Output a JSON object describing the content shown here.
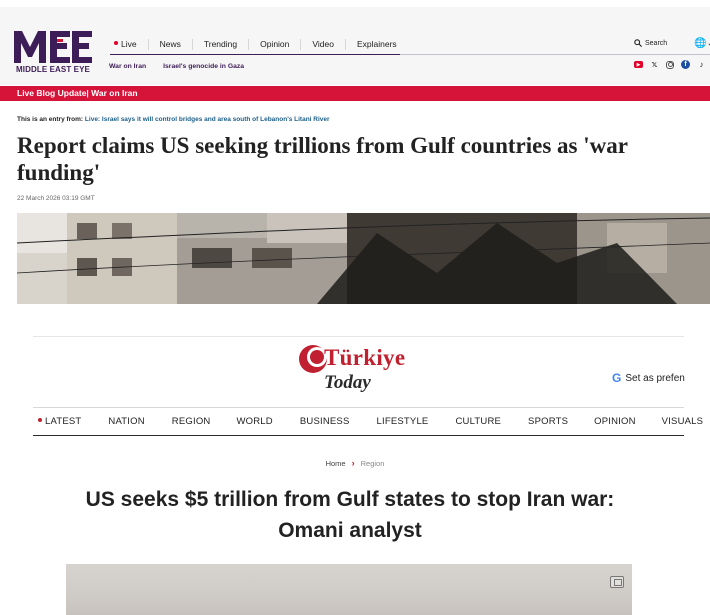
{
  "mee": {
    "logo_text": "MIDDLE EAST EYE",
    "nav": [
      {
        "label": "Live",
        "live": true
      },
      {
        "label": "News"
      },
      {
        "label": "Trending"
      },
      {
        "label": "Opinion"
      },
      {
        "label": "Video"
      },
      {
        "label": "Explainers"
      }
    ],
    "sublinks": [
      "War on Iran",
      "Israel's genocide in Gaza"
    ],
    "search_label": "Search",
    "social_icons": [
      "youtube-icon",
      "x-icon",
      "instagram-icon",
      "facebook-icon",
      "tiktok-icon"
    ],
    "red_bar": "Live Blog Update| War on Iran",
    "entry_prefix": "This is an entry from:",
    "entry_link": "Live: Israel says it will control bridges and area south of Lebanon's Litani River",
    "headline": "Report claims US seeking trillions from Gulf countries as 'war funding'",
    "date": "22 March 2026 03:19 GMT",
    "colors": {
      "brand": "#3c1d57",
      "live_red": "#d6143a",
      "link": "#1c5f8a"
    }
  },
  "tt": {
    "logo_line1": "Türkiye",
    "logo_line2": "Today",
    "pref_label": "Set as prefen",
    "nav": [
      {
        "label": "LATEST",
        "live": true
      },
      {
        "label": "NATION"
      },
      {
        "label": "REGION"
      },
      {
        "label": "WORLD"
      },
      {
        "label": "BUSINESS"
      },
      {
        "label": "LIFESTYLE"
      },
      {
        "label": "CULTURE"
      },
      {
        "label": "SPORTS"
      },
      {
        "label": "OPINION"
      },
      {
        "label": "VISUALS"
      }
    ],
    "breadcrumb": {
      "home": "Home",
      "current": "Region"
    },
    "headline": "US seeks $5 trillion from Gulf states to stop Iran war: Omani analyst",
    "colors": {
      "brand_red": "#c0202f"
    }
  }
}
